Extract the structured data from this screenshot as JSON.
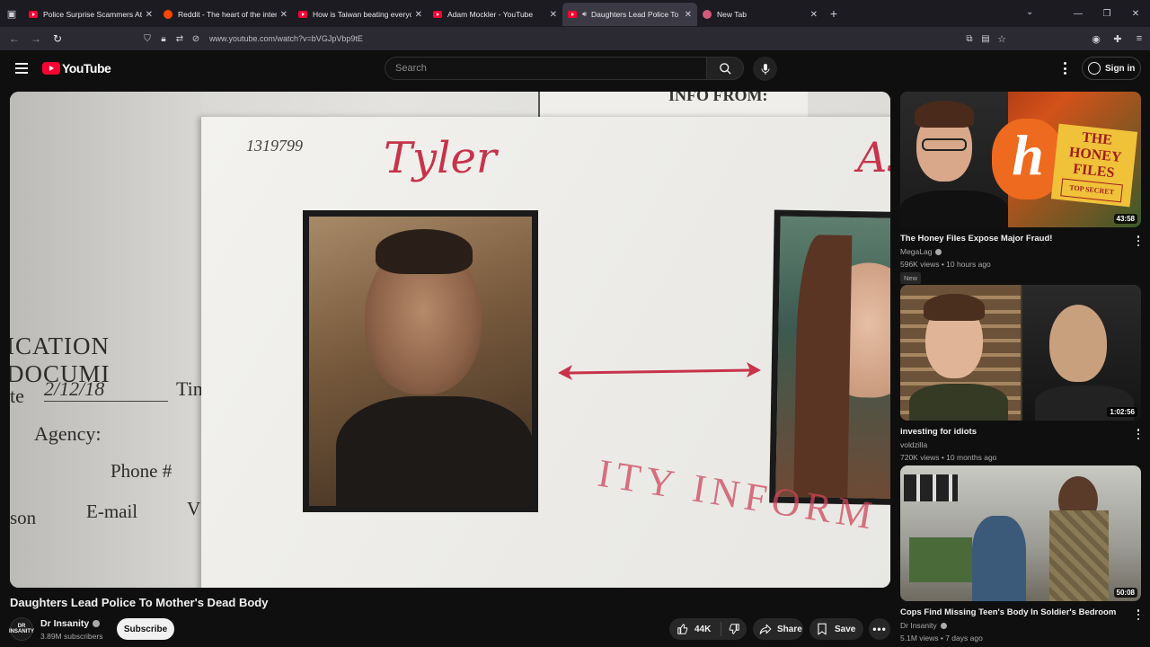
{
  "browser": {
    "tabs": [
      {
        "title": "Police Surprise Scammers At Th",
        "favicon": "youtube",
        "active": false
      },
      {
        "title": "Reddit - The heart of the intern",
        "favicon": "reddit",
        "active": false
      },
      {
        "title": "How is Taiwan beating everyone",
        "favicon": "youtube",
        "active": false
      },
      {
        "title": "Adam Mockler - YouTube",
        "favicon": "youtube",
        "active": false
      },
      {
        "title": "Daughters Lead Police To M",
        "favicon": "youtube",
        "active": true,
        "playing_audio": true
      },
      {
        "title": "New Tab",
        "favicon": "newtab",
        "active": false
      }
    ],
    "url": "www.youtube.com/watch?v=bVGJpVbp9tE"
  },
  "header": {
    "logo_text": "YouTube",
    "search_placeholder": "Search",
    "signin_label": "Sign in"
  },
  "player": {
    "doc_number": "1319799",
    "info_from": "INFO FROM:",
    "name_left": "Tyler",
    "name_right": "As",
    "form_lines": [
      "ICATION DOCUMI",
      "te",
      "2/12/18",
      "Tin",
      "Agency:",
      "Phone #",
      "son",
      "E-mail",
      "V"
    ],
    "stamp_text": "ITY INFORM"
  },
  "video": {
    "title": "Daughters Lead Police To Mother's Dead Body",
    "channel_name": "Dr Insanity",
    "channel_avatar_text": "DR INSANITY",
    "subscribers": "3.89M subscribers",
    "subscribe_label": "Subscribe",
    "likes": "44K",
    "share_label": "Share",
    "save_label": "Save"
  },
  "recommendations": [
    {
      "title": "The Honey Files Expose Major Fraud!",
      "channel": "MegaLag",
      "verified": true,
      "meta": "596K views • 10 hours ago",
      "badge": "New",
      "duration": "43:58",
      "thumb_text": [
        "THE",
        "HONEY",
        "FILES",
        "TOP SECRET"
      ],
      "thumb_letter": "h"
    },
    {
      "title": "investing for idiots",
      "channel": "voldzilla",
      "verified": false,
      "meta": "720K views • 10 months ago",
      "badge": "",
      "duration": "1:02:56"
    },
    {
      "title": "Cops Find Missing Teen's Body In Soldier's Bedroom",
      "channel": "Dr Insanity",
      "verified": true,
      "meta": "5.1M views • 7 days ago",
      "badge": "",
      "duration": "50:08"
    }
  ],
  "colors": {
    "bg": "#0f0f0f",
    "accent_red": "#ff0033",
    "stamp_red": "#c8334a"
  }
}
